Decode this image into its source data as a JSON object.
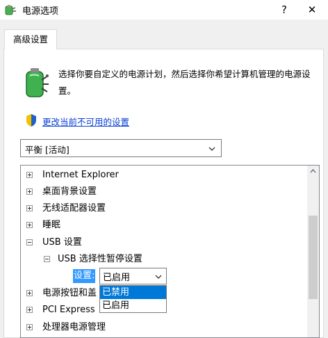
{
  "window": {
    "title": "电源选项",
    "help_glyph": "?",
    "close_glyph": "✕"
  },
  "tab": {
    "label": "高级设置"
  },
  "intro": {
    "text": "选择你要自定义的电源计划，然后选择你希望计算机管理的电源设置。"
  },
  "change_link": {
    "label": "更改当前不可用的设置"
  },
  "plan_select": {
    "value": "平衡 [活动]"
  },
  "tree": {
    "items": [
      {
        "label": "Internet Explorer"
      },
      {
        "label": "桌面背景设置"
      },
      {
        "label": "无线适配器设置"
      },
      {
        "label": "睡眠"
      },
      {
        "label": "USB 设置"
      },
      {
        "label": "USB 选择性暂停设置"
      },
      {
        "label": "电源按钮和盖"
      },
      {
        "label": "PCI Express"
      },
      {
        "label": "处理器电源管理"
      }
    ],
    "setting_label": "设置:",
    "setting_value": "已启用",
    "options": [
      "已禁用",
      "已启用"
    ]
  },
  "colors": {
    "link": "#0a3fd6",
    "selection": "#3399ff",
    "option_highlight": "#0078d7"
  }
}
